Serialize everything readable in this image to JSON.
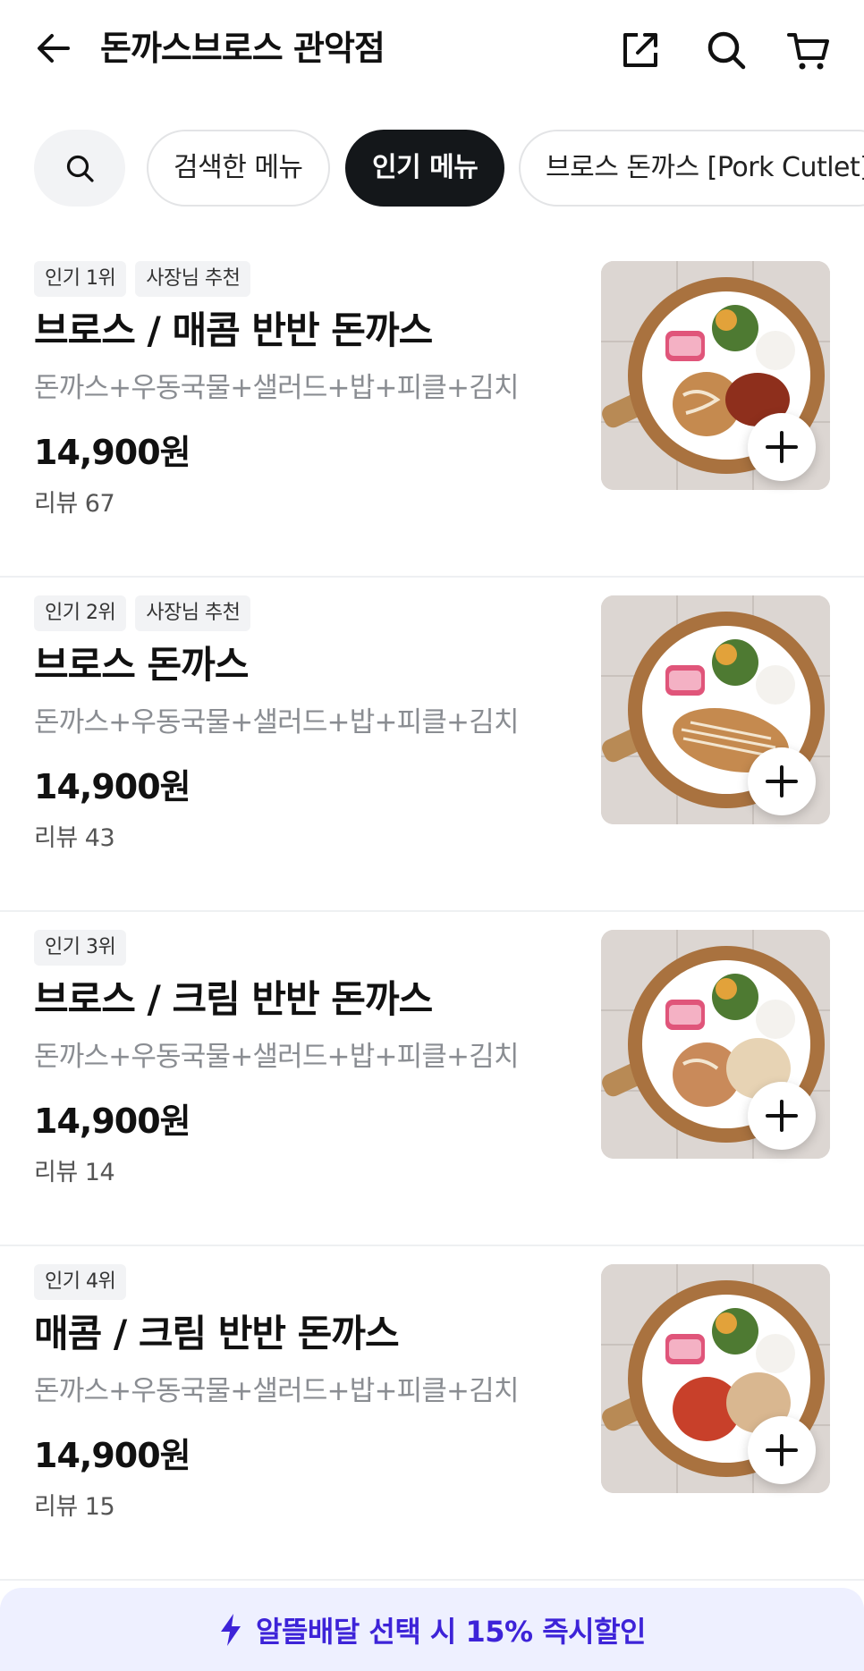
{
  "header": {
    "title": "돈까스브로스 관악점",
    "icons": [
      "back-arrow-icon",
      "share-icon",
      "search-icon",
      "cart-icon"
    ]
  },
  "tabs": {
    "search_icon": "search-icon",
    "chips": [
      {
        "label": "검색한 메뉴",
        "active": false
      },
      {
        "label": "인기 메뉴",
        "active": true
      },
      {
        "label": "브로스 돈까스 [Pork Cutlet]",
        "active": false
      }
    ]
  },
  "menu": [
    {
      "badges": [
        "인기 1위",
        "사장님 추천"
      ],
      "name": "브로스 / 매콤 반반 돈까스",
      "desc": "돈까스+우동국물+샐러드+밥+피클+김치",
      "price": "14,900원",
      "review": "리뷰 67"
    },
    {
      "badges": [
        "인기 2위",
        "사장님 추천"
      ],
      "name": "브로스 돈까스",
      "desc": "돈까스+우동국물+샐러드+밥+피클+김치",
      "price": "14,900원",
      "review": "리뷰 43"
    },
    {
      "badges": [
        "인기 3위"
      ],
      "name": "브로스 / 크림 반반 돈까스",
      "desc": "돈까스+우동국물+샐러드+밥+피클+김치",
      "price": "14,900원",
      "review": "리뷰 14"
    },
    {
      "badges": [
        "인기 4위"
      ],
      "name": "매콤 / 크림 반반 돈까스",
      "desc": "돈까스+우동국물+샐러드+밥+피클+김치",
      "price": "14,900원",
      "review": "리뷰 15"
    }
  ],
  "banner": {
    "icon": "lightning-icon",
    "text": "알뜰배달 선택 시 15% 즉시할인"
  },
  "colors": {
    "accent": "#3d23d8",
    "banner_bg": "#eef0ff",
    "chip_active_bg": "#14171a"
  }
}
